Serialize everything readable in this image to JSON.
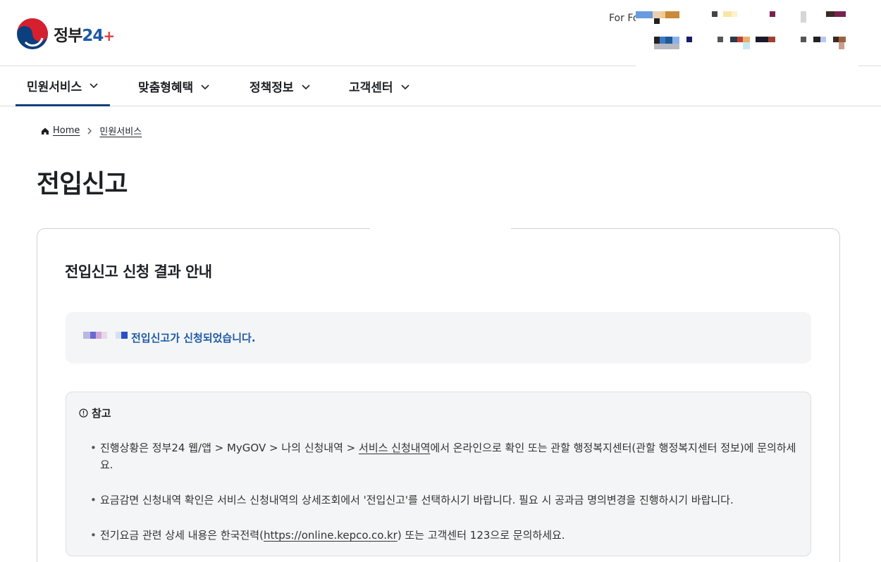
{
  "header": {
    "logo_text": "정부",
    "logo_number": "24",
    "logo_plus": "+",
    "for_foreigners": "For Fo"
  },
  "nav": {
    "items": [
      {
        "label": "민원서비스",
        "active": true
      },
      {
        "label": "맞춤형혜택",
        "active": false
      },
      {
        "label": "정책정보",
        "active": false
      },
      {
        "label": "고객센터",
        "active": false
      }
    ]
  },
  "breadcrumb": {
    "home": "Home",
    "current": "민원서비스"
  },
  "page": {
    "title": "전입신고"
  },
  "card": {
    "title": "전입신고 신청 결과 안내",
    "result_message": "전입신고가 신청되었습니다.",
    "note": {
      "heading": "참고",
      "item1_before": "진행상황은 정부24 웹/앱 > MyGOV > 나의 신청내역 > ",
      "item1_link": "서비스 신청내역",
      "item1_after": "에서 온라인으로 확인 또는 관할 행정복지센터(관할 행정복지센터 정보)에 문의하세요.",
      "item2": "요금감면 신청내역 확인은 서비스 신청내역의 상세조회에서 '전입신고'를 선택하시기 바랍니다. 필요 시 공과금 명의변경을 진행하시기 바랍니다.",
      "item3_before": "전기요금 관련 상세 내용은 한국전력(",
      "item3_link": "https://online.kepco.co.kr",
      "item3_after": ") 또는 고객센터 123으로 문의하세요."
    }
  },
  "colors": {
    "brand_blue": "#1d5aa5",
    "nav_active": "#0b3f7e",
    "box_bg": "#f4f5f6"
  }
}
